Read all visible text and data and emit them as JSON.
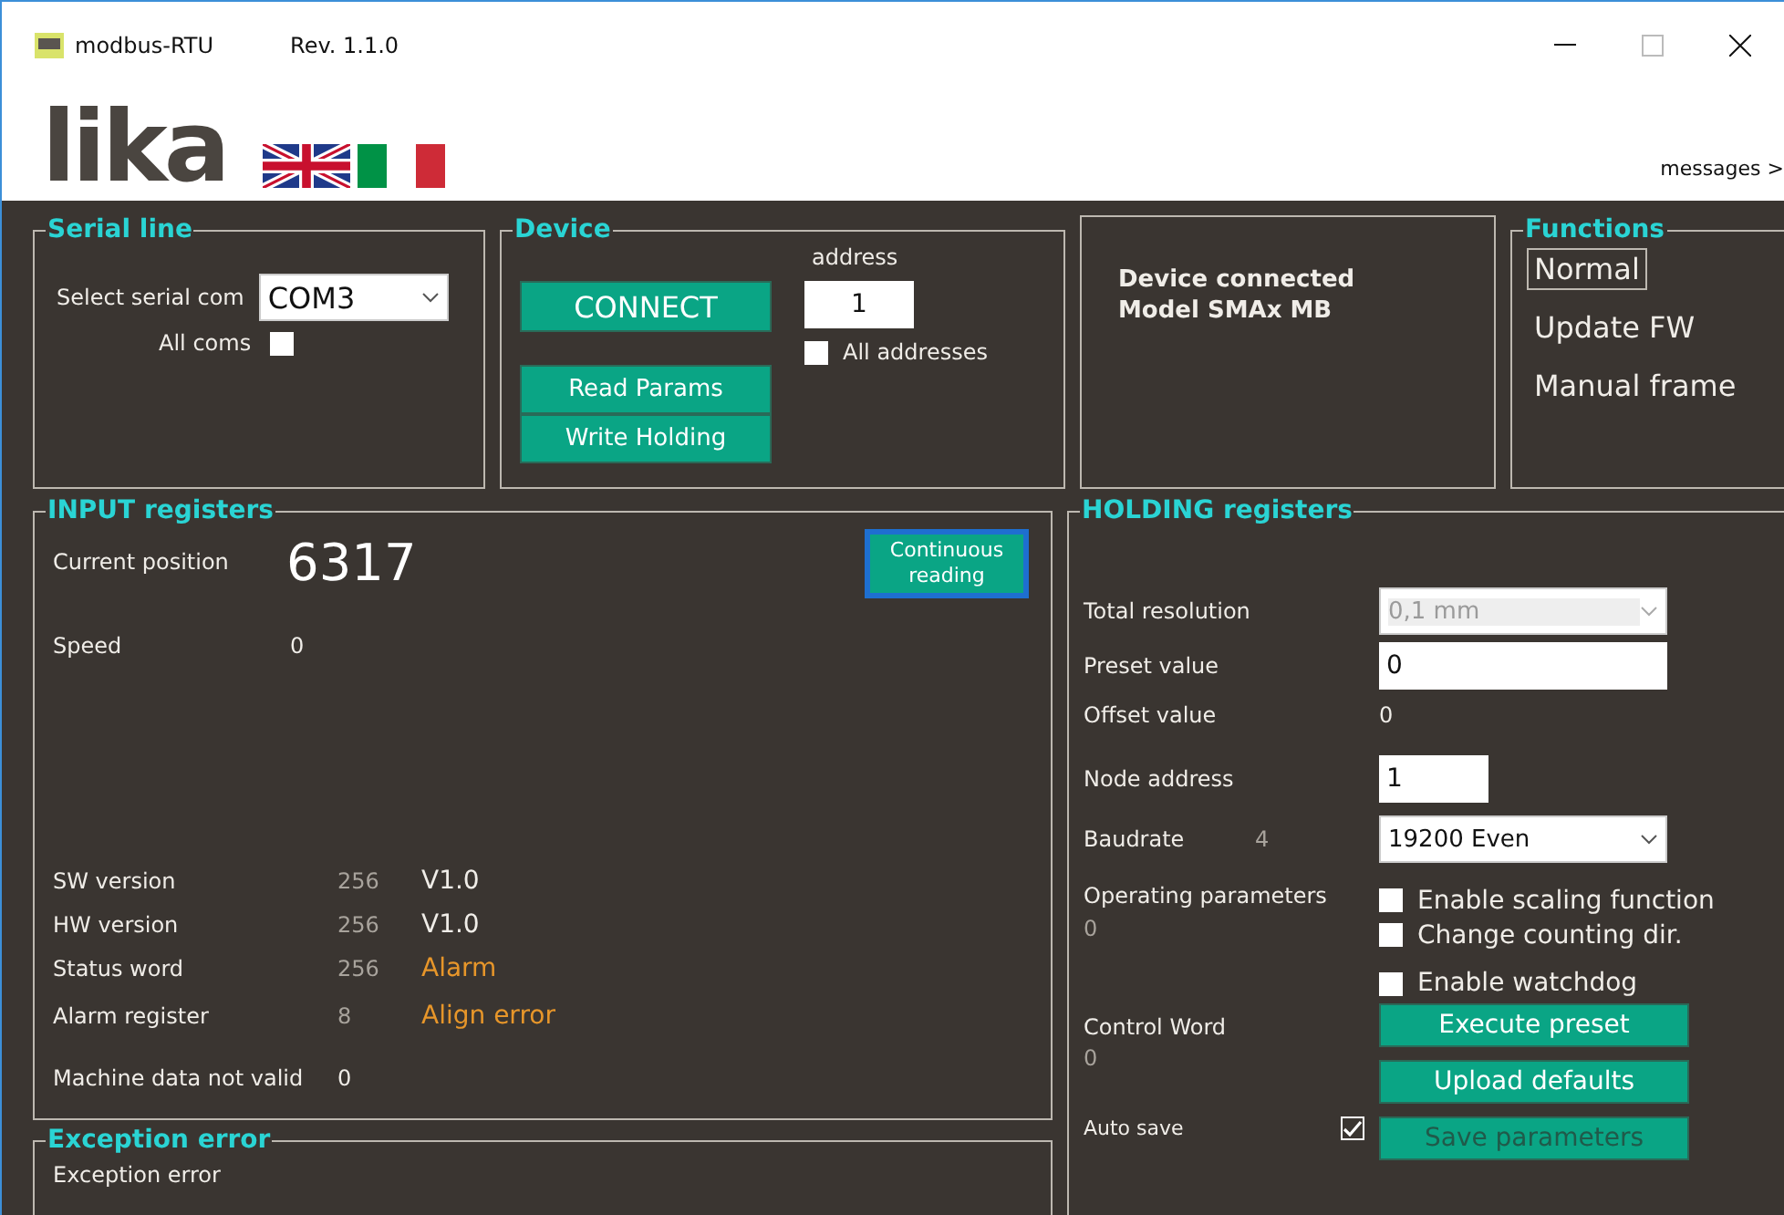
{
  "window": {
    "title": "modbus-RTU",
    "revision": "Rev. 1.1.0"
  },
  "header": {
    "logo": "lika",
    "messages_link": "messages >"
  },
  "serial_line": {
    "title": "Serial line",
    "com_label": "Select serial com",
    "com_value": "COM3",
    "all_coms_label": "All coms",
    "all_coms_checked": false
  },
  "device": {
    "title": "Device",
    "connect": "CONNECT",
    "read_params": "Read Params",
    "write_holding": "Write Holding",
    "address_label": "address",
    "address_value": "1",
    "all_addresses_label": "All addresses",
    "all_addresses_checked": false
  },
  "status": {
    "lines": [
      "Device connected",
      "Model  SMAx MB"
    ]
  },
  "functions": {
    "title": "Functions",
    "items": [
      {
        "label": "Normal",
        "selected": true
      },
      {
        "label": "Update FW",
        "selected": false
      },
      {
        "label": "Manual frame",
        "selected": false
      }
    ]
  },
  "input_registers": {
    "title": "INPUT registers",
    "continuous_reading": "Continuous reading",
    "position_label": "Current position",
    "position_value": "6317",
    "speed_label": "Speed",
    "speed_value": "0",
    "rows": [
      {
        "label": "SW version",
        "raw": "256",
        "value": "V1.0",
        "alarm": false
      },
      {
        "label": "HW version",
        "raw": "256",
        "value": "V1.0",
        "alarm": false
      },
      {
        "label": "Status word",
        "raw": "256",
        "value": "Alarm",
        "alarm": true
      },
      {
        "label": "Alarm register",
        "raw": "8",
        "value": "Align error",
        "alarm": true
      },
      {
        "label": "Machine data not valid",
        "raw": "0"
      }
    ]
  },
  "exception": {
    "title": "Exception error",
    "text": "Exception error"
  },
  "holding": {
    "title": "HOLDING registers",
    "total_resolution": {
      "label": "Total resolution",
      "value": "0,1  mm",
      "disabled": true
    },
    "preset": {
      "label": "Preset value",
      "value": "0"
    },
    "offset": {
      "label": "Offset value",
      "value": "0"
    },
    "node_address": {
      "label": "Node address",
      "value": "1"
    },
    "baudrate": {
      "label": "Baudrate",
      "raw": "4",
      "value": "19200  Even"
    },
    "operating": {
      "label": "Operating parameters",
      "raw": "0",
      "options": [
        {
          "label": "Enable scaling function",
          "checked": false
        },
        {
          "label": "Change counting dir.",
          "checked": false
        }
      ]
    },
    "watchdog": {
      "label": "Enable watchdog",
      "checked": false
    },
    "control_word": {
      "label": "Control  Word",
      "raw": "0"
    },
    "buttons": [
      {
        "label": "Execute preset",
        "disabled": false
      },
      {
        "label": "Upload defaults",
        "disabled": false
      },
      {
        "label": "Save parameters",
        "disabled": true
      }
    ],
    "auto_save": {
      "label": "Auto save",
      "checked": true
    }
  }
}
